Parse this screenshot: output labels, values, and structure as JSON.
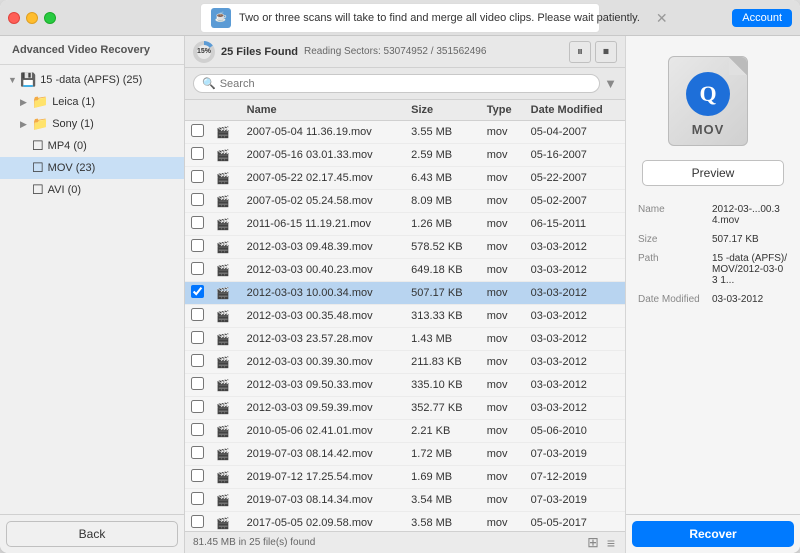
{
  "window": {
    "titlebar": {
      "notification_text": "Two or three scans will take to find and merge all video clips. Please wait patiently.",
      "notif_icon_char": "☕",
      "account_label": "Account"
    }
  },
  "sidebar": {
    "title": "Advanced Video Recovery",
    "items": [
      {
        "id": "root",
        "label": "15 -data (APFS) (25)",
        "indent": 0,
        "arrow": "▼",
        "icon": "💾",
        "count": "25"
      },
      {
        "id": "leica",
        "label": "Leica (1)",
        "indent": 1,
        "arrow": "▶",
        "icon": "📁"
      },
      {
        "id": "sony",
        "label": "Sony (1)",
        "indent": 1,
        "arrow": "▶",
        "icon": "📁"
      },
      {
        "id": "mp4",
        "label": "MP4 (0)",
        "indent": 1,
        "arrow": "",
        "icon": "☐"
      },
      {
        "id": "mov",
        "label": "MOV (23)",
        "indent": 1,
        "arrow": "",
        "icon": "☐",
        "selected": true
      },
      {
        "id": "avi",
        "label": "AVI (0)",
        "indent": 1,
        "arrow": "",
        "icon": "☐"
      }
    ],
    "back_label": "Back"
  },
  "toolbar": {
    "progress_pct": "15%",
    "files_found": "25 Files Found",
    "reading_label": "Reading Sectors: 53074952 / 351562496",
    "pause_icon": "⏸",
    "stop_icon": "⏹"
  },
  "search": {
    "placeholder": "Search"
  },
  "table": {
    "columns": [
      "",
      "",
      "Name",
      "Size",
      "Type",
      "Date Modified"
    ],
    "rows": [
      {
        "name": "2007-05-04 11.36.19.mov",
        "size": "3.55 MB",
        "type": "mov",
        "date": "05-04-2007",
        "selected": false
      },
      {
        "name": "2007-05-16 03.01.33.mov",
        "size": "2.59 MB",
        "type": "mov",
        "date": "05-16-2007",
        "selected": false
      },
      {
        "name": "2007-05-22 02.17.45.mov",
        "size": "6.43 MB",
        "type": "mov",
        "date": "05-22-2007",
        "selected": false
      },
      {
        "name": "2007-05-02 05.24.58.mov",
        "size": "8.09 MB",
        "type": "mov",
        "date": "05-02-2007",
        "selected": false
      },
      {
        "name": "2011-06-15 11.19.21.mov",
        "size": "1.26 MB",
        "type": "mov",
        "date": "06-15-2011",
        "selected": false
      },
      {
        "name": "2012-03-03 09.48.39.mov",
        "size": "578.52 KB",
        "type": "mov",
        "date": "03-03-2012",
        "selected": false
      },
      {
        "name": "2012-03-03 00.40.23.mov",
        "size": "649.18 KB",
        "type": "mov",
        "date": "03-03-2012",
        "selected": false
      },
      {
        "name": "2012-03-03 10.00.34.mov",
        "size": "507.17 KB",
        "type": "mov",
        "date": "03-03-2012",
        "selected": true
      },
      {
        "name": "2012-03-03 00.35.48.mov",
        "size": "313.33 KB",
        "type": "mov",
        "date": "03-03-2012",
        "selected": false
      },
      {
        "name": "2012-03-03 23.57.28.mov",
        "size": "1.43 MB",
        "type": "mov",
        "date": "03-03-2012",
        "selected": false
      },
      {
        "name": "2012-03-03 00.39.30.mov",
        "size": "211.83 KB",
        "type": "mov",
        "date": "03-03-2012",
        "selected": false
      },
      {
        "name": "2012-03-03 09.50.33.mov",
        "size": "335.10 KB",
        "type": "mov",
        "date": "03-03-2012",
        "selected": false
      },
      {
        "name": "2012-03-03 09.59.39.mov",
        "size": "352.77 KB",
        "type": "mov",
        "date": "03-03-2012",
        "selected": false
      },
      {
        "name": "2010-05-06 02.41.01.mov",
        "size": "2.21 KB",
        "type": "mov",
        "date": "05-06-2010",
        "selected": false
      },
      {
        "name": "2019-07-03 08.14.42.mov",
        "size": "1.72 MB",
        "type": "mov",
        "date": "07-03-2019",
        "selected": false
      },
      {
        "name": "2019-07-12 17.25.54.mov",
        "size": "1.69 MB",
        "type": "mov",
        "date": "07-12-2019",
        "selected": false
      },
      {
        "name": "2019-07-03 08.14.34.mov",
        "size": "3.54 MB",
        "type": "mov",
        "date": "07-03-2019",
        "selected": false
      },
      {
        "name": "2017-05-05 02.09.58.mov",
        "size": "3.58 MB",
        "type": "mov",
        "date": "05-05-2017",
        "selected": false
      }
    ],
    "footer_text": "81.45 MB in 25 file(s) found"
  },
  "preview": {
    "icon_label": "MOV",
    "preview_btn_label": "Preview",
    "meta": {
      "name_key": "Name",
      "name_val": "2012-03-...00.34.mov",
      "size_key": "Size",
      "size_val": "507.17 KB",
      "path_key": "Path",
      "path_val": "15 -data (APFS)/\nMOV/2012-03-03 1...",
      "date_key": "Date Modified",
      "date_val": "03-03-2012"
    },
    "recover_label": "Recover"
  }
}
